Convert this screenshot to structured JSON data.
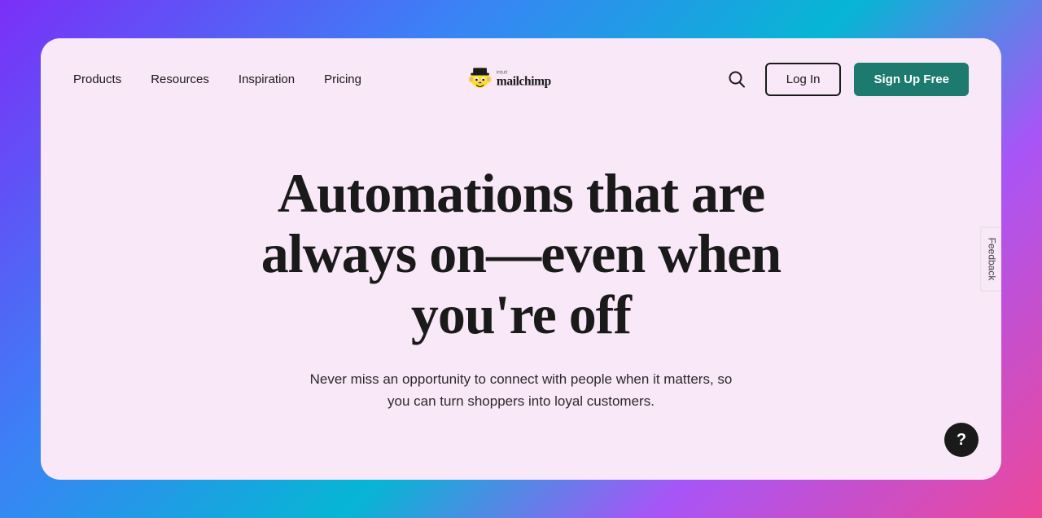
{
  "page": {
    "background": "gradient",
    "card_bg": "#f9e8f8"
  },
  "navbar": {
    "nav_items": [
      {
        "label": "Products",
        "id": "products"
      },
      {
        "label": "Resources",
        "id": "resources"
      },
      {
        "label": "Inspiration",
        "id": "inspiration"
      },
      {
        "label": "Pricing",
        "id": "pricing"
      }
    ],
    "logo_alt": "Intuit Mailchimp",
    "search_label": "Search",
    "login_label": "Log In",
    "signup_label": "Sign Up Free"
  },
  "hero": {
    "title": "Automations that are always on—even when you're off",
    "subtitle": "Never miss an opportunity to connect with people when it matters, so you can turn shoppers into loyal customers."
  },
  "feedback": {
    "label": "Feedback"
  },
  "help": {
    "label": "?"
  }
}
